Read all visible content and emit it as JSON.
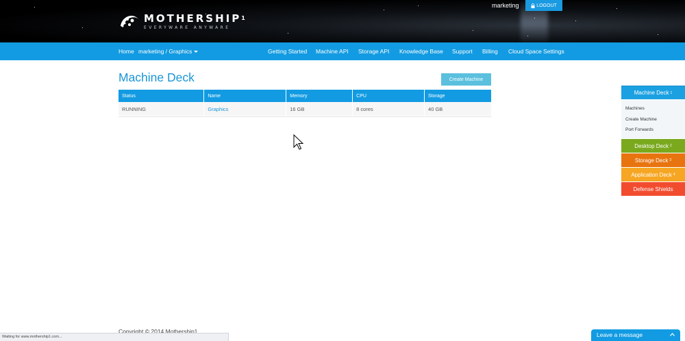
{
  "header": {
    "logo_title": "MOTHERSHIP",
    "logo_superscript": "1",
    "logo_tagline": "EVERYWARE ANYWARE",
    "username": "marketing",
    "logout_label": "LOGOUT",
    "logout_icon": "lock-icon"
  },
  "nav": {
    "home": "Home",
    "space_selector": "marketing / Graphics",
    "getting_started": "Getting Started",
    "machine_api": "Machine API",
    "storage_api": "Storage API",
    "knowledge_base": "Knowledge Base",
    "support": "Support",
    "billing": "Billing",
    "cloud_space_settings": "Cloud Space Settings"
  },
  "main": {
    "title": "Machine Deck",
    "create_button": "Create Machine",
    "table": {
      "headers": [
        "Status",
        "Name",
        "Memory",
        "CPU",
        "Storage"
      ],
      "rows": [
        [
          "RUNNING",
          "Graphics",
          "16 GB",
          "8 cores",
          "40 GB"
        ]
      ]
    }
  },
  "side_panel": {
    "machine_deck": {
      "label": "Machine Deck",
      "num": "1",
      "color": "#1ba1e2"
    },
    "sub_items": [
      "Machines",
      "Create Machine",
      "Port Forwards"
    ],
    "desktop_deck": {
      "label": "Desktop Deck",
      "num": "2",
      "color": "#7aa91e"
    },
    "storage_deck": {
      "label": "Storage Deck",
      "num": "3",
      "color": "#e8740f"
    },
    "application_deck": {
      "label": "Application Deck",
      "num": "4",
      "color": "#f6a623"
    },
    "defense_shields": {
      "label": "Defense Shields",
      "color": "#f24c2f"
    }
  },
  "footer": {
    "copyright": "Copyright © 2014 Mothership1",
    "status_text": "Waiting for www.mothership1.com...",
    "chat_label": "Leave a message",
    "chat_icon": "chevron-up-icon"
  },
  "colors": {
    "accent": "#129be2",
    "title": "#1a95d6",
    "create_button": "#5bc0de"
  }
}
